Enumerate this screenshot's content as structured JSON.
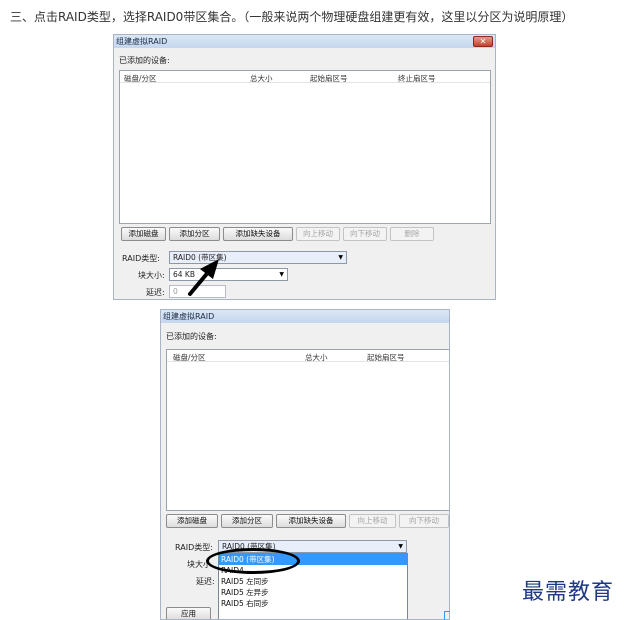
{
  "instruction": "三、点击RAID类型，选择RAID0带区集合。（一般来说两个物理硬盘组建更有效，这里以分区为说明原理）",
  "dialog1": {
    "title": "组建虚拟RAID",
    "close": "✕",
    "added_devices_label": "已添加的设备:",
    "columns": [
      "磁盘/分区",
      "总大小",
      "起始扇区号",
      "终止扇区号"
    ],
    "buttons": {
      "add_disk": "添加磁盘",
      "add_partition": "添加分区",
      "add_missing": "添加缺失设备",
      "move_up": "向上移动",
      "move_down": "向下移动",
      "delete": "删除"
    },
    "raid_type_label": "RAID类型:",
    "raid_type_value": "RAID0 (带区集)",
    "block_size_label": "块大小:",
    "block_size_value": "64 KB",
    "delay_label": "延迟:",
    "delay_value": "0"
  },
  "dialog2": {
    "title": "组建虚拟RAID",
    "added_devices_label": "已添加的设备:",
    "columns": [
      "磁盘/分区",
      "总大小",
      "起始扇区号"
    ],
    "buttons": {
      "add_disk": "添加磁盘",
      "add_partition": "添加分区",
      "add_missing": "添加缺失设备",
      "move_up": "向上移动",
      "move_down": "向下移动",
      "apply": "应用"
    },
    "raid_type_label": "RAID类型:",
    "raid_type_value": "RAID0 (带区集)",
    "block_size_label_partial": "块大小",
    "delay_label": "延迟:",
    "options": [
      "RAID0 (带区集)",
      "RAID4",
      "RAID5 左同步",
      "RAID5 左异步",
      "RAID5 右同步"
    ]
  },
  "watermark": "最需教育",
  "colors": {
    "selection": "#3399ff",
    "watermark": "#1f3a82",
    "close_button": "#c5412c"
  }
}
